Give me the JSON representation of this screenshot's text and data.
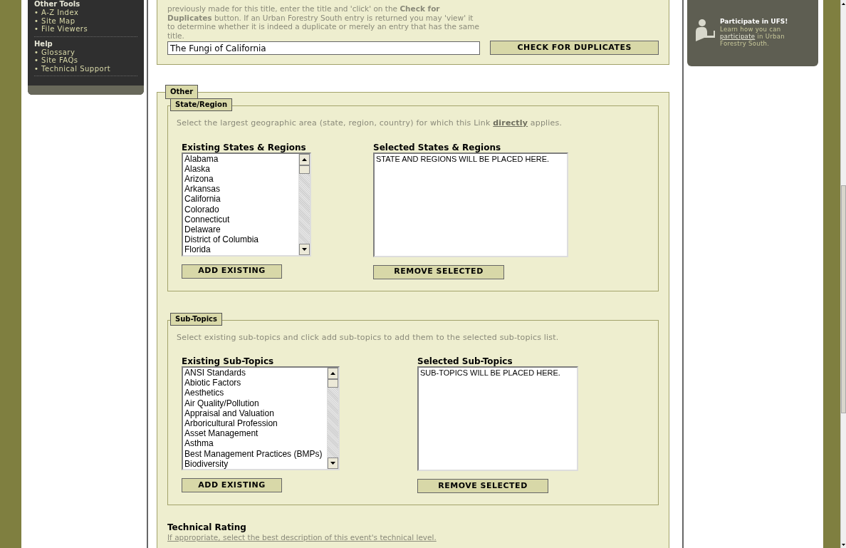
{
  "sidebar": {
    "sections": [
      {
        "heading": "Other Tools",
        "items": [
          "• A-Z Index",
          "• Site Map",
          "• File Viewers"
        ]
      },
      {
        "heading": "Help",
        "items": [
          "• Glossary",
          "• Site FAQs",
          "• Technical Support"
        ]
      }
    ]
  },
  "duplicate_check": {
    "instructions": "previously made for this title, enter the title and 'click' on the **Check for Duplicates** button. If an Urban Forestry South entry is returned you may 'view' it to determine whether it is indeed a duplicate or merely an entry that has the same title.",
    "title_value": "The Fungi of California",
    "button": "CHECK FOR DUPLICATES"
  },
  "other": {
    "legend": "Other",
    "groups": [
      {
        "legend": "State/Region",
        "description_start": "Select the largest geographic area (state, region, country) for which this Link",
        "description_link": "directly",
        "description_end": "applies.",
        "existing_label": "Existing States & Regions",
        "existing_items": [
          "Alabama",
          "Alaska",
          "Arizona",
          "Arkansas",
          "California",
          "Colorado",
          "Connecticut",
          "Delaware",
          "District of Columbia",
          "Florida"
        ],
        "selected_label": "Selected States & Regions",
        "selected_items": [
          "STATE AND REGIONS WILL BE PLACED HERE."
        ],
        "add_button": "ADD EXISTING",
        "remove_button": "REMOVE SELECTED"
      },
      {
        "legend": "Sub-Topics",
        "description_start": "Select existing sub-topics and click add sub-topics to add them to the selected sub-topics list.",
        "existing_label": "Existing Sub-Topics",
        "existing_items": [
          "ANSI Standards",
          "Abiotic Factors",
          "Aesthetics",
          "Air Quality/Pollution",
          "Appraisal and Valuation",
          "Arboricultural Profession",
          "Asset Management",
          "Asthma",
          "Best Management Practices (BMPs)",
          "Biodiversity"
        ],
        "selected_label": "Selected Sub-Topics",
        "selected_items": [
          "SUB-TOPICS WILL BE PLACED HERE."
        ],
        "add_button": "ADD EXISTING",
        "remove_button": "REMOVE SELECTED"
      }
    ]
  },
  "technical_rating": {
    "label": "Technical Rating",
    "description": "If appropriate, select the best description of this event's technical level."
  },
  "promo": {
    "title": "Participate in UFS!",
    "text_start": "Learn how you can",
    "link": "participate",
    "text_end": "in Urban Forestry South."
  }
}
